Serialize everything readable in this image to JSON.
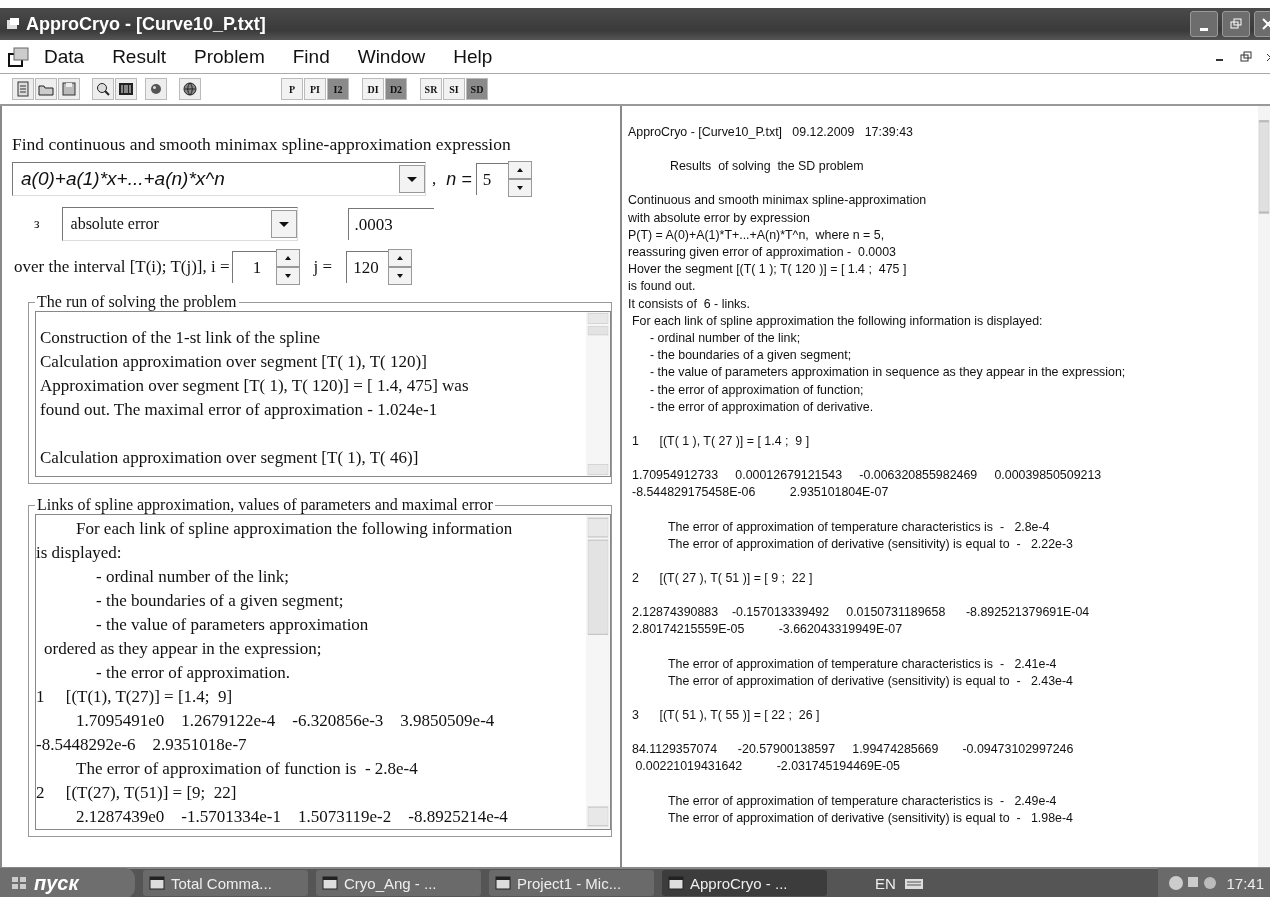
{
  "window": {
    "title": "ApproCryo - [Curve10_P.txt]"
  },
  "menu": {
    "items": [
      "Data",
      "Result",
      "Problem",
      "Find",
      "Window",
      "Help"
    ]
  },
  "toolbar": {
    "text_groups": [
      [
        {
          "label": "P",
          "pressed": false
        },
        {
          "label": "PI",
          "pressed": false
        },
        {
          "label": "I2",
          "pressed": true
        }
      ],
      [
        {
          "label": "DI",
          "pressed": false
        },
        {
          "label": "D2",
          "pressed": true
        }
      ],
      [
        {
          "label": "SR",
          "pressed": false
        },
        {
          "label": "SI",
          "pressed": false
        },
        {
          "label": "SD",
          "pressed": true
        }
      ]
    ]
  },
  "form": {
    "heading": "Find continuous and smooth minimax spline-approximation expression",
    "expression": "a(0)+a(1)*x+...+a(n)*x^n",
    "separator": ",",
    "n_label": "n =",
    "n_value": "5",
    "error_symbol": "з",
    "error_type": "absolute error",
    "error_value": ".0003",
    "interval_label": "over the interval [T(i); T(j)], i =",
    "i_value": "1",
    "j_label": "j =",
    "j_value": "120"
  },
  "run_group": {
    "title": "The run of solving the problem",
    "paragraphs": [
      [
        "Construction of the 1-st link of the spline",
        "Calculation approximation over segment [T( 1), T( 120)]",
        "Approximation over segment [T( 1), T( 120)] = [ 1.4, 475] was",
        "found out. The maximal error of approximation - 1.024e-1"
      ],
      [
        "Calculation approximation over segment [T( 1), T( 46)]"
      ]
    ]
  },
  "links_group": {
    "title": "Links of spline approximation, values of parameters and maximal error",
    "lines": [
      {
        "kind": "para",
        "text": "For each link of spline approximation the following information"
      },
      {
        "kind": "plain",
        "text": "is displayed:"
      },
      {
        "kind": "item",
        "text": "- ordinal number of the link;"
      },
      {
        "kind": "item",
        "text": "- the boundaries of a given segment;"
      },
      {
        "kind": "item",
        "text": "- the value of parameters approximation"
      },
      {
        "kind": "lead",
        "text": "ordered as they appear in the expression;"
      },
      {
        "kind": "item",
        "text": "- the error of approximation."
      },
      {
        "kind": "plain",
        "text": "1     [(T(1), T(27)] = [1.4;  9]"
      },
      {
        "kind": "indent",
        "text": "1.7095491e0    1.2679122e-4    -6.320856e-3    3.9850509e-4"
      },
      {
        "kind": "plain",
        "text": "-8.5448292e-6    2.9351018e-7"
      },
      {
        "kind": "indent",
        "text": "The error of approximation of function is  - 2.8e-4"
      },
      {
        "kind": "plain",
        "text": "2     [(T(27), T(51)] = [9;  22]"
      },
      {
        "kind": "indent",
        "text": "2.1287439e0    -1.5701334e-1    1.5073119e-2    -8.8925214e-4"
      }
    ]
  },
  "report": {
    "blocks": [
      [
        {
          "kind": "text",
          "text": "ApproCryo - [Curve10_P.txt]   09.12.2009   17:39:43"
        }
      ],
      [
        {
          "kind": "subtitle",
          "text": "Results  of solving  the SD problem"
        }
      ],
      [
        {
          "kind": "text",
          "text": "Continuous and smooth minimax spline-approximation"
        },
        {
          "kind": "text",
          "text": "with absolute error by expression"
        },
        {
          "kind": "text",
          "text": "P(T) = A(0)+A(1)*T+...+A(n)*T^n,  where n = 5,"
        },
        {
          "kind": "text",
          "text": "reassuring given error of approximation -  0.0003"
        },
        {
          "kind": "text",
          "text": "Hover the segment [(T( 1 ); T( 120 )] = [ 1.4 ;  475 ]"
        },
        {
          "kind": "text",
          "text": "is found out."
        },
        {
          "kind": "text",
          "text": "It consists of  6 - links."
        },
        {
          "kind": "lead",
          "text": "For each link of spline approximation the following information is displayed:"
        },
        {
          "kind": "item",
          "text": "- ordinal number of the link;"
        },
        {
          "kind": "item",
          "text": "- the boundaries of a given segment;"
        },
        {
          "kind": "item",
          "text": "- the value of parameters approximation in sequence as they appear in the expression;"
        },
        {
          "kind": "item",
          "text": "- the error of approximation of function;"
        },
        {
          "kind": "item",
          "text": "- the error of approximation of derivative."
        }
      ],
      [
        {
          "kind": "lead",
          "text": "1      [(T( 1 ), T( 27 )] = [ 1.4 ;  9 ]"
        }
      ],
      [
        {
          "kind": "lead",
          "text": "1.70954912733     0.00012679121543     -0.006320855982469     0.00039850509213"
        },
        {
          "kind": "lead",
          "text": "-8.544829175458E-06          2.935101804E-07"
        }
      ],
      [
        {
          "kind": "error",
          "text": "The error of approximation of temperature characteristics is  -   2.8e-4"
        },
        {
          "kind": "error",
          "text": "The error of approximation of derivative (sensitivity) is equal to  -   2.22e-3"
        }
      ],
      [
        {
          "kind": "lead",
          "text": "2      [(T( 27 ), T( 51 )] = [ 9 ;  22 ]"
        }
      ],
      [
        {
          "kind": "lead",
          "text": "2.12874390883    -0.157013339492     0.0150731189658      -8.892521379691E-04"
        },
        {
          "kind": "lead",
          "text": "2.80174215559E-05          -3.662043319949E-07"
        }
      ],
      [
        {
          "kind": "error",
          "text": "The error of approximation of temperature characteristics is  -   2.41e-4"
        },
        {
          "kind": "error",
          "text": "The error of approximation of derivative (sensitivity) is equal to  -   2.43e-4"
        }
      ],
      [
        {
          "kind": "lead",
          "text": "3      [(T( 51 ), T( 55 )] = [ 22 ;  26 ]"
        }
      ],
      [
        {
          "kind": "lead",
          "text": "84.1129357074      -20.57900138597     1.99474285669       -0.09473102997246"
        },
        {
          "kind": "lead",
          "text": " 0.00221019431642          -2.031745194469E-05"
        }
      ],
      [
        {
          "kind": "error",
          "text": "The error of approximation of temperature characteristics is  -   2.49e-4"
        },
        {
          "kind": "error",
          "text": "The error of approximation of derivative (sensitivity) is equal to  -   1.98e-4"
        }
      ]
    ]
  },
  "taskbar": {
    "start": "пуск",
    "tasks": [
      {
        "label": "Total Comma...",
        "selected": false
      },
      {
        "label": "Cryo_Ang - ...",
        "selected": false
      },
      {
        "label": "Project1 - Mic...",
        "selected": false
      },
      {
        "label": "ApproCryo - ...",
        "selected": true
      }
    ],
    "language": "EN",
    "clock": "17:41"
  }
}
